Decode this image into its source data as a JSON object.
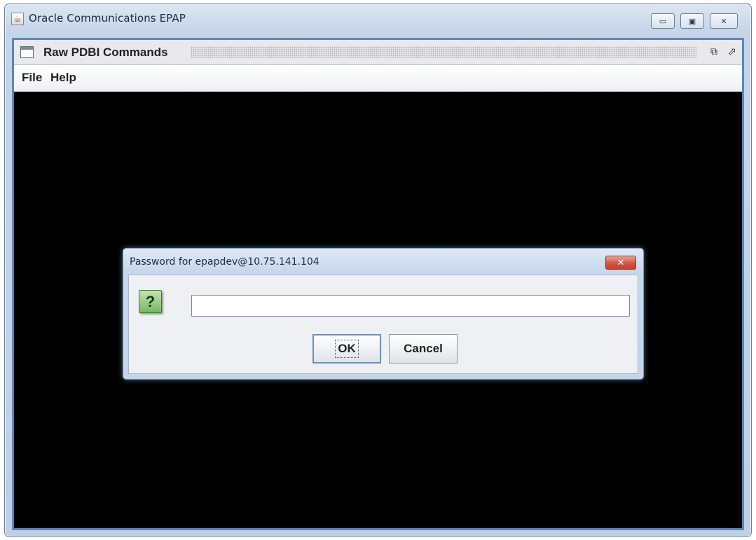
{
  "app": {
    "title": "Oracle Communications EPAP",
    "app_icon": "java-coffee-icon",
    "controls": {
      "minimize_icon": "minimize-icon",
      "maximize_icon": "maximize-icon",
      "close_icon": "close-icon"
    }
  },
  "internal_frame": {
    "title": "Raw PDBI Commands",
    "icon": "window-frame-icon",
    "iconify_icon": "iconify-icon",
    "maximize_icon": "maximize-frame-icon"
  },
  "menubar": {
    "items": [
      {
        "label": "File"
      },
      {
        "label": "Help"
      }
    ]
  },
  "dialog": {
    "title": "Password for epapdev@10.75.141.104",
    "close_icon": "close-icon",
    "question_icon": "question-icon",
    "question_glyph": "?",
    "password_value": "",
    "ok_label": "OK",
    "cancel_label": "Cancel"
  },
  "colors": {
    "frame_border": "#5e84b8",
    "console_background": "#000000",
    "dialog_close_red": "#d25440",
    "question_green": "#77b860"
  }
}
